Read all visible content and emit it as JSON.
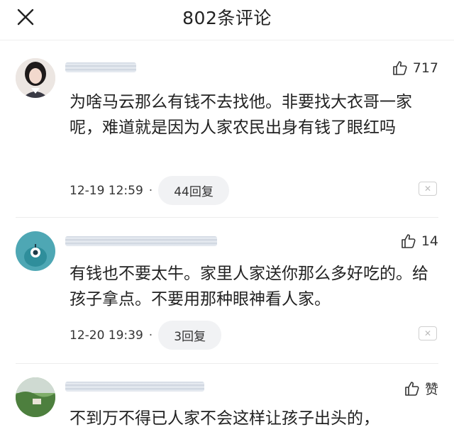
{
  "header": {
    "title": "802条评论",
    "close_icon": "close-icon"
  },
  "comments": [
    {
      "likes": "717",
      "text": "为啥马云那么有钱不去找他。非要找大衣哥一家呢，难道就是因为人家农民出身有钱了眼红吗",
      "time": "12-19 12:59",
      "replies": "44回复"
    },
    {
      "likes": "14",
      "text": "有钱也不要太牛。家里人家送你那么多好吃的。给孩子拿点。不要用那种眼神看人家。",
      "time": "12-20 19:39",
      "replies": "3回复"
    },
    {
      "likes": "赞",
      "text": "不到万不得已人家不会这样让孩子出头的，"
    }
  ],
  "meta": {
    "separator": "·"
  },
  "colors": {
    "avatar2_bg": "#4ea7b4",
    "accent_text": "#222222"
  }
}
